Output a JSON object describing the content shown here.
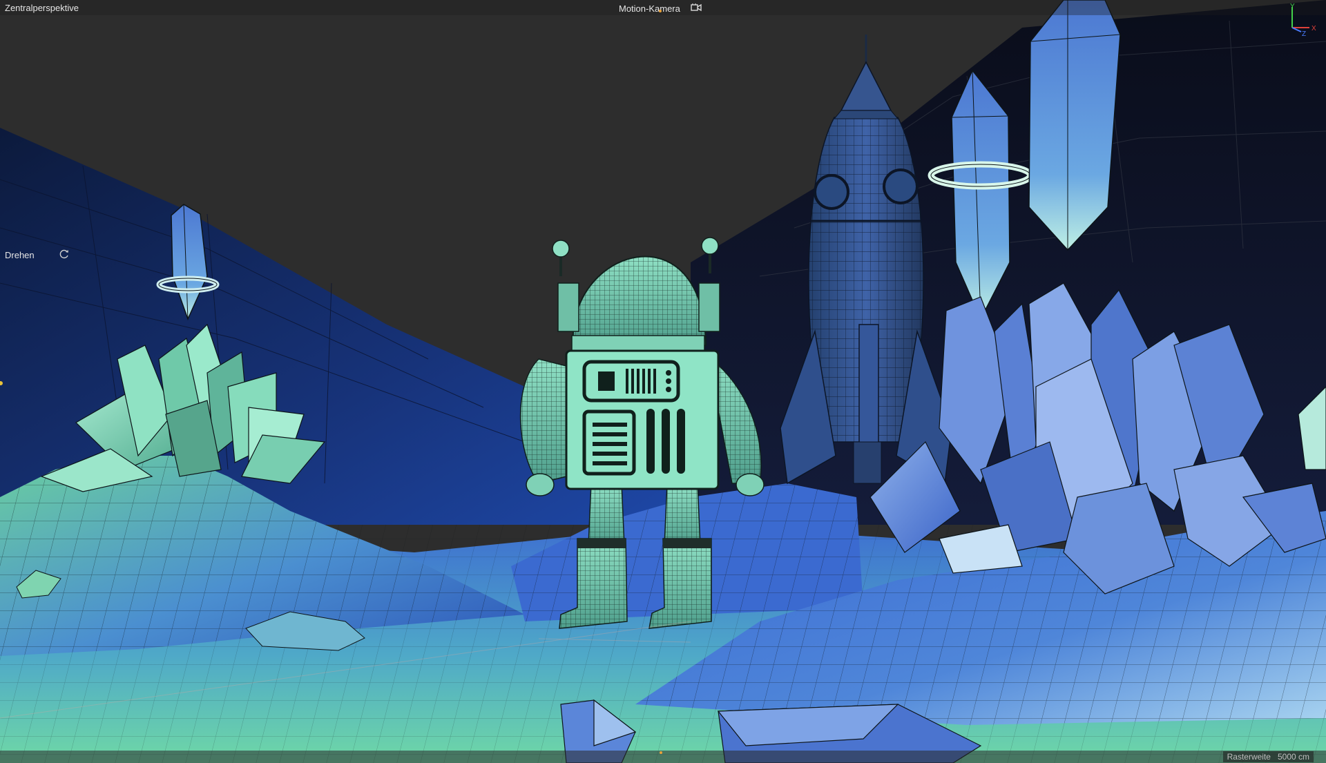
{
  "viewport": {
    "view_name": "Zentralperspektive",
    "camera_name": "Motion-Kamera",
    "camera_icon": "camera-icon",
    "tool_label": "Drehen",
    "tool_icon": "rotate-icon",
    "axes": {
      "y": "Y",
      "z": "Z",
      "x": "X"
    },
    "grid_label": "Rasterweite",
    "grid_value": "5000 cm"
  },
  "scene_objects": {
    "character": "astronaut",
    "vehicle": "rocket",
    "props": [
      "crystal-cluster",
      "floating-crystal",
      "terrain"
    ]
  },
  "colors": {
    "background": "#2d2d2d",
    "sky": "#06080f",
    "ground_green": "#6fd6a8",
    "ground_blue": "#3f6bd6",
    "crystal_blue": "#5b86d9",
    "crystal_green": "#7ddbb6",
    "wire": "#0d1418",
    "axis_x": "#e0413a",
    "axis_y": "#43d14a",
    "axis_z": "#4a7cff",
    "accent": "#e8a23a"
  }
}
